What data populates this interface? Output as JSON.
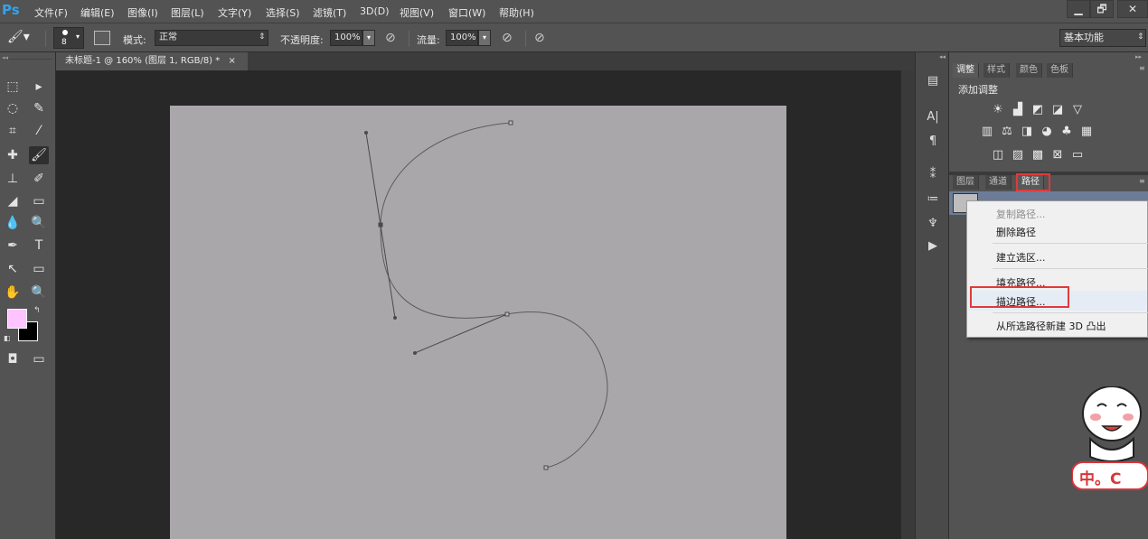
{
  "app": {
    "logo": "Ps"
  },
  "menu": [
    "文件(F)",
    "编辑(E)",
    "图像(I)",
    "图层(L)",
    "文字(Y)",
    "选择(S)",
    "滤镜(T)",
    "3D(D)",
    "视图(V)",
    "窗口(W)",
    "帮助(H)"
  ],
  "window_controls": {
    "minimize": "▁",
    "restore": "🗗",
    "close": "✕"
  },
  "options": {
    "brush_size": "8",
    "mode_label": "模式:",
    "mode_value": "正常",
    "opacity_label": "不透明度:",
    "opacity_value": "100%",
    "flow_label": "流量:",
    "flow_value": "100%",
    "workspace": "基本功能"
  },
  "document": {
    "tab_title": "未标题-1 @ 160% (图层 1, RGB/8) *",
    "tab_close": "×",
    "canvas_color": "#aaa7ab"
  },
  "colors": {
    "foreground": "#ffc3ff",
    "background": "#000000",
    "accent_red": "#e03a3a"
  },
  "panels": {
    "top_tabs": [
      "调整",
      "样式",
      "颜色",
      "色板"
    ],
    "add_adjustment": "添加调整",
    "bottom_tabs": [
      "图层",
      "通道",
      "路径"
    ],
    "active_bottom_tab": "路径"
  },
  "context_menu": {
    "items": [
      {
        "label": "复制路径...",
        "enabled": false
      },
      {
        "label": "删除路径",
        "enabled": true
      },
      {
        "label": "建立选区...",
        "enabled": true
      },
      {
        "label": "填充路径...",
        "enabled": true
      },
      {
        "label": "描边路径...",
        "enabled": true,
        "highlighted": true
      },
      {
        "label": "从所选路径新建 3D 凸出",
        "enabled": true
      }
    ]
  },
  "watermark": {
    "text": "中。C"
  },
  "icons": {
    "tools": [
      "marquee-icon",
      "move-icon",
      "lasso-icon",
      "quick-select-icon",
      "crop-icon",
      "eyedropper-icon",
      "healing-icon",
      "brush-icon",
      "stamp-icon",
      "history-brush-icon",
      "eraser-icon",
      "gradient-icon",
      "blur-icon",
      "dodge-icon",
      "pen-icon",
      "text-icon",
      "path-select-icon",
      "shape-icon",
      "hand-icon",
      "zoom-icon"
    ]
  }
}
